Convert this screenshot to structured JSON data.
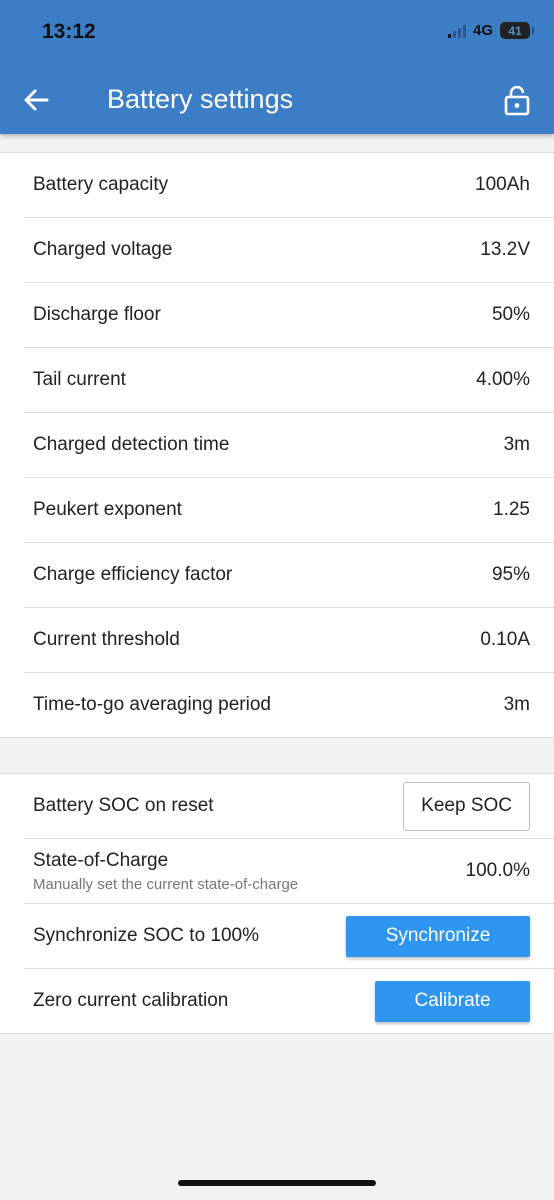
{
  "status_bar": {
    "time": "13:12",
    "network": "4G",
    "battery_level": "41"
  },
  "header": {
    "title": "Battery settings",
    "back_icon": "arrow-left-icon",
    "lock_icon": "lock-icon"
  },
  "settings": [
    {
      "label": "Battery capacity",
      "value": "100Ah"
    },
    {
      "label": "Charged voltage",
      "value": "13.2V"
    },
    {
      "label": "Discharge floor",
      "value": "50%"
    },
    {
      "label": "Tail current",
      "value": "4.00%"
    },
    {
      "label": "Charged detection time",
      "value": "3m"
    },
    {
      "label": "Peukert exponent",
      "value": "1.25"
    },
    {
      "label": "Charge efficiency factor",
      "value": "95%"
    },
    {
      "label": "Current threshold",
      "value": "0.10A"
    },
    {
      "label": "Time-to-go averaging period",
      "value": "3m"
    }
  ],
  "soc": {
    "reset": {
      "label": "Battery SOC on reset",
      "button": "Keep SOC"
    },
    "state": {
      "label": "State-of-Charge",
      "sublabel": "Manually set the current state-of-charge",
      "value": "100.0%"
    },
    "sync": {
      "label": "Synchronize SOC to 100%",
      "button": "Synchronize"
    },
    "zero": {
      "label": "Zero current calibration",
      "button": "Calibrate"
    }
  },
  "colors": {
    "appbar": "#3b7ec5",
    "primary_button": "#2e96f0",
    "background": "#f2f2f2"
  }
}
